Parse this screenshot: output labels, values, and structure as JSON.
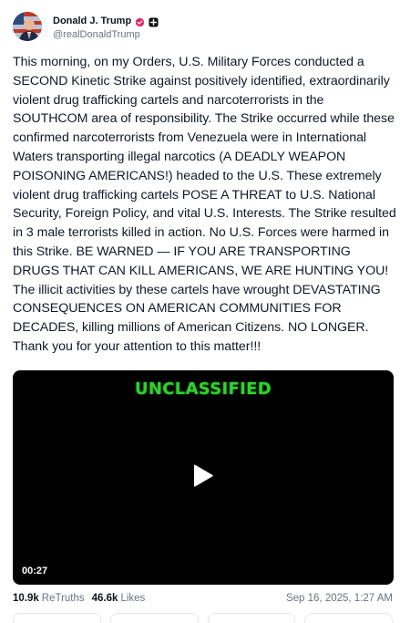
{
  "author": {
    "display_name": "Donald J. Trump",
    "handle": "@realDonaldTrump"
  },
  "post": {
    "text": "This morning, on my Orders, U.S. Military Forces conducted a SECOND Kinetic Strike against positively identified, extraordinarily violent drug trafficking cartels and narcoterrorists in the SOUTHCOM area of responsibility. The Strike occurred while these confirmed narcoterrorists from Venezuela were in International Waters transporting illegal narcotics (A DEADLY WEAPON POISONING AMERICANS!) headed to the U.S. These extremely violent drug trafficking cartels POSE A THREAT to U.S. National Security, Foreign Policy, and vital U.S. Interests. The Strike resulted in 3 male terrorists killed in action. No U.S. Forces were harmed in this Strike. BE WARNED — IF YOU ARE TRANSPORTING DRUGS THAT CAN KILL AMERICANS, WE ARE HUNTING YOU! The illicit activities by these cartels have wrought DEVASTATING CONSEQUENCES ON AMERICAN COMMUNITIES FOR DECADES, killing millions of American Citizens. NO LONGER. Thank you for your attention to this matter!!!"
  },
  "video": {
    "banner_text": "UNCLASSIFIED",
    "duration": "00:27"
  },
  "stats": {
    "retruths_count": "10.9k",
    "retruths_label": "ReTruths",
    "likes_count": "46.6k",
    "likes_label": "Likes",
    "timestamp": "Sep 16, 2025, 1:27 AM"
  },
  "colors": {
    "verified_badge": "#e0245e",
    "banner_green": "#2fd12f",
    "muted_text": "#6b7280"
  },
  "icons": {
    "verified": "verified-badge-icon",
    "account": "square-badge-icon",
    "play": "play-icon"
  }
}
